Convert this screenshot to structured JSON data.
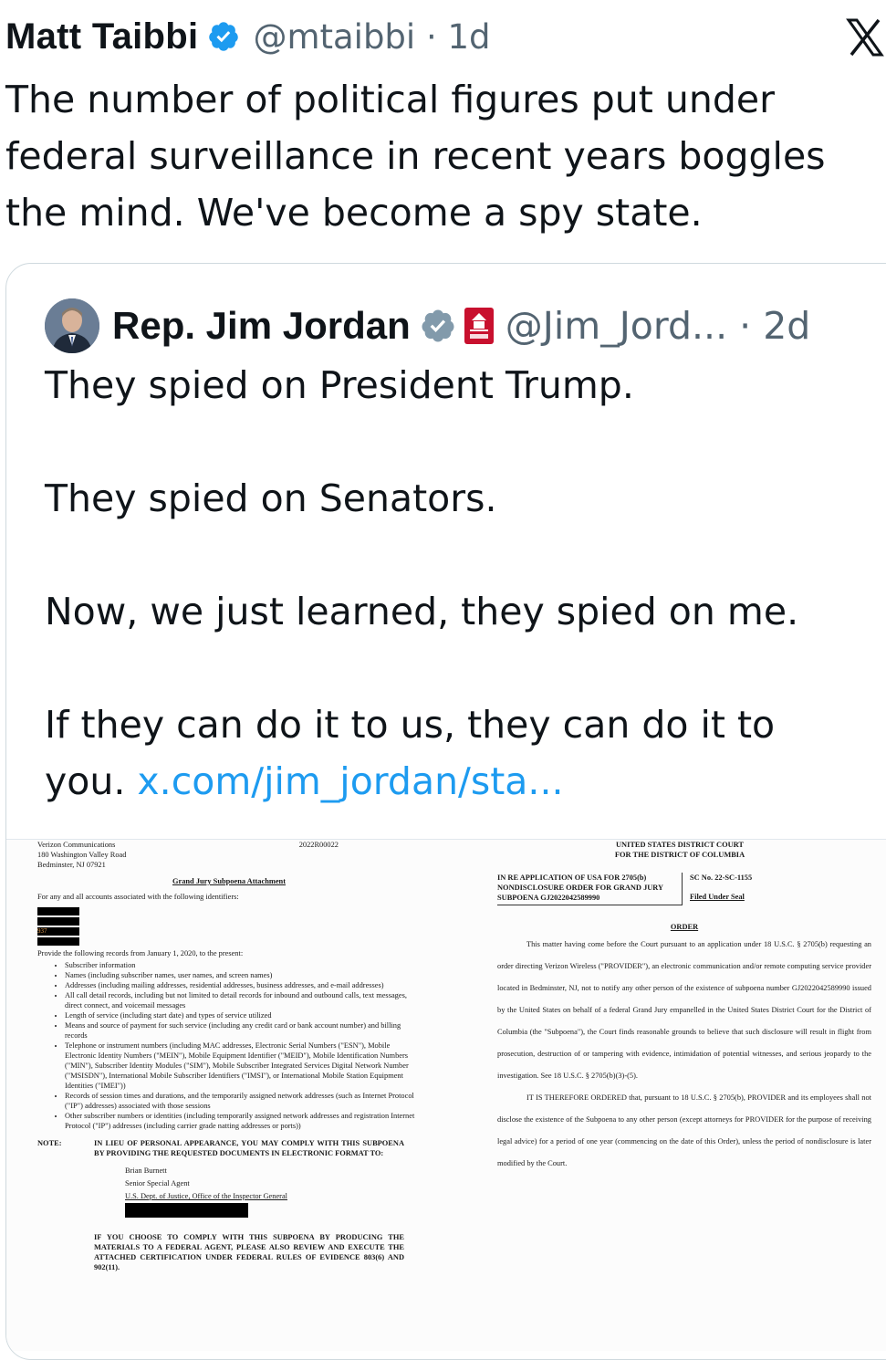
{
  "tweet": {
    "author_name": "Matt Taibbi",
    "handle_time": "@mtaibbi · 1d",
    "text": "The number of political figures put under\nfederal surveillance in recent years boggles\nthe mind. We've become a spy state."
  },
  "quoted_tweet": {
    "author_name": "Rep. Jim Jordan",
    "handle_time": "@Jim_Jord... · 2d",
    "text": "They spied on President Trump.\n\nThey spied on Senators.\n\nNow, we just learned, they spied on me.\n\nIf they can do it to us, they can do it to\nyou. ",
    "link": "x.com/jim_jordan/sta..."
  },
  "colors": {
    "accent": "#1d9bf0",
    "verified_blue": "#1d9bf0",
    "verified_gray": "#829aab",
    "text": "#0f1419",
    "muted": "#536471"
  },
  "icons": {
    "verified": "verified-badge-icon",
    "gop": "house-gop-badge-icon",
    "x": "x-logo-icon"
  },
  "document_left": {
    "company": "Verizon Communications",
    "ref": "2022R00022",
    "addr1": "180 Washington Valley Road",
    "addr2": "Bedminster, NJ 07921",
    "title": "Grand Jury Subpoena Attachment",
    "intro": "For any and all accounts associated with the following identifiers:",
    "redact_tag": "937",
    "provide": "Provide the following records from January 1, 2020, to the present:",
    "items": [
      "Subscriber information",
      "Names (including subscriber names, user names, and screen names)",
      "Addresses (including mailing addresses, residential addresses, business addresses, and e-mail addresses)",
      "All call detail records, including but not limited to detail records for inbound and outbound calls, text messages, direct connect, and voicemail messages",
      "Length of service (including start date) and types of service utilized",
      "Means and source of payment for such service (including any credit card or bank account number) and billing records",
      "Telephone or instrument numbers (including MAC addresses, Electronic Serial Numbers (\"ESN\"), Mobile Electronic Identity Numbers (\"MEIN\"), Mobile Equipment Identifier (\"MEID\"), Mobile Identification Numbers (\"MIN\"), Subscriber Identity Modules (\"SIM\"), Mobile Subscriber Integrated Services Digital Network Number (\"MSISDN\"), International Mobile Subscriber Identifiers (\"IMSI\"), or International Mobile Station Equipment Identities (\"IMEI\"))",
      "Records of session times and durations, and the temporarily assigned network addresses (such as Internet Protocol (\"IP\") addresses) associated with those sessions",
      "Other subscriber numbers or identities (including temporarily assigned network addresses and registration Internet Protocol (\"IP\") addresses (including carrier grade natting addresses or ports))"
    ],
    "note_label": "NOTE:",
    "note_text": "IN LIEU OF PERSONAL APPEARANCE, YOU MAY COMPLY WITH THIS SUBPOENA BY PROVIDING THE REQUESTED DOCUMENTS IN ELECTRONIC FORMAT TO:",
    "agent_name": "Brian Burnett",
    "agent_title": "Senior Special Agent",
    "agent_office": "U.S. Dept. of Justice, Office of the Inspector General",
    "closing": "IF YOU CHOOSE TO COMPLY WITH THIS SUBPOENA BY PRODUCING THE MATERIALS TO A FEDERAL AGENT, PLEASE ALSO REVIEW AND EXECUTE THE ATTACHED CERTIFICATION UNDER FEDERAL RULES OF EVIDENCE 803(6) AND 902(11)."
  },
  "document_right": {
    "court1": "UNITED STATES DISTRICT COURT",
    "court2": "FOR THE DISTRICT OF COLUMBIA",
    "caption": "IN RE APPLICATION OF USA FOR 2705(b) NONDISCLOSURE ORDER FOR GRAND JURY SUBPOENA GJ2022042589990",
    "case_no": "SC No. 22-SC-1155",
    "filed": "Filed Under Seal",
    "order_title": "ORDER",
    "para1": "This matter having come before the Court pursuant to an application under 18 U.S.C. § 2705(b) requesting an order directing Verizon Wireless (\"PROVIDER\"), an electronic communication and/or remote computing service provider located in Bedminster, NJ, not to notify any other person of the existence of subpoena number GJ2022042589990 issued by the United States on behalf of a federal Grand Jury empanelled in the United States District Court for the District of Columbia (the \"Subpoena\"), the Court finds reasonable grounds to believe that such disclosure will result in flight from prosecution, destruction of or tampering with evidence, intimidation of potential witnesses, and serious jeopardy to the investigation. See 18 U.S.C. § 2705(b)(3)-(5).",
    "para2": "IT IS THEREFORE ORDERED that, pursuant to 18 U.S.C. § 2705(b), PROVIDER and its employees shall not disclose the existence of the Subpoena to any other person (except attorneys for PROVIDER for the purpose of receiving legal advice) for a period of one year (commencing on the date of this Order), unless the period of nondisclosure is later modified by the Court."
  }
}
